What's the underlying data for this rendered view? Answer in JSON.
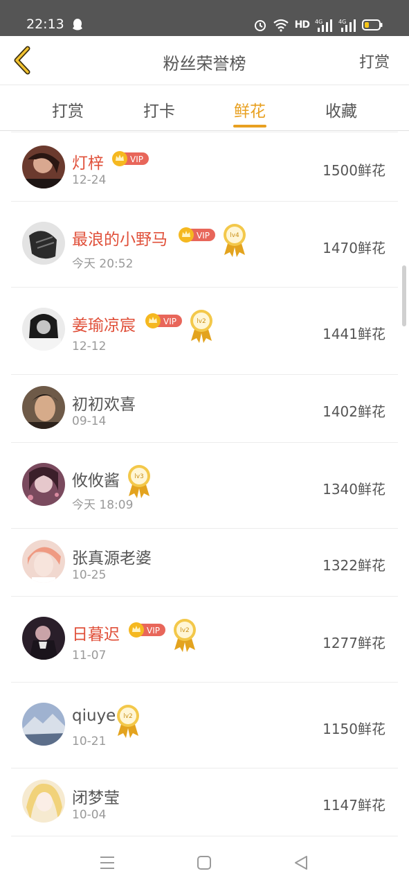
{
  "status_bar": {
    "time": "22:13",
    "hd_label": "HD",
    "icons": [
      "qq-icon",
      "alarm-icon",
      "wifi-icon",
      "signal-4g-icon",
      "signal-4g-icon",
      "battery-icon"
    ]
  },
  "header": {
    "title": "粉丝荣誉榜",
    "action_label": "打赏",
    "back_icon": "chevron-left-icon"
  },
  "tabs": [
    {
      "label": "打赏",
      "active": false
    },
    {
      "label": "打卡",
      "active": false
    },
    {
      "label": "鲜花",
      "active": true
    },
    {
      "label": "收藏",
      "active": false
    }
  ],
  "vip_label": "VIP",
  "items": [
    {
      "name": "灯梓",
      "date": "12-24",
      "count": "1500鲜花",
      "vip": true,
      "level": null
    },
    {
      "name": "最浪的小野马",
      "date": "今天 20:52",
      "count": "1470鲜花",
      "vip": true,
      "level": "lv4"
    },
    {
      "name": "姜瑜凉宸",
      "date": "12-12",
      "count": "1441鲜花",
      "vip": true,
      "level": "lv2"
    },
    {
      "name": "初初欢喜",
      "date": "09-14",
      "count": "1402鲜花",
      "vip": false,
      "level": null
    },
    {
      "name": "攸攸酱",
      "date": "今天 18:09",
      "count": "1340鲜花",
      "vip": false,
      "level": "lv3"
    },
    {
      "name": "张真源老婆",
      "date": "10-25",
      "count": "1322鲜花",
      "vip": false,
      "level": null
    },
    {
      "name": "日暮迟",
      "date": "11-07",
      "count": "1277鲜花",
      "vip": true,
      "level": "lv2"
    },
    {
      "name": "qiuye",
      "date": "10-21",
      "count": "1150鲜花",
      "vip": false,
      "level": "lv2"
    },
    {
      "name": "闭梦莹",
      "date": "10-04",
      "count": "1147鲜花",
      "vip": false,
      "level": null
    }
  ],
  "colors": {
    "accent": "#e8a020",
    "vip_name": "#e0503a",
    "text": "#555555",
    "muted": "#999999",
    "status_bar": "#555555"
  },
  "navbar": {
    "icons": [
      "menu-icon",
      "home-icon",
      "back-icon"
    ]
  }
}
